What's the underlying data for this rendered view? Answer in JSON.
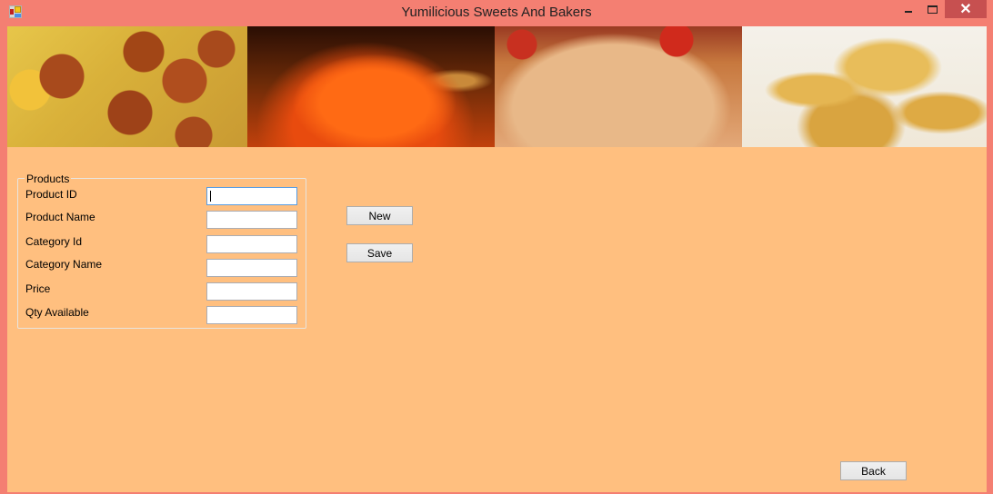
{
  "window": {
    "title": "Yumilicious Sweets And Bakers",
    "icon": "app-icon",
    "controls": {
      "minimize": "minimize-icon",
      "maximize": "maximize-icon",
      "close": "✕"
    }
  },
  "banner": {
    "images": [
      {
        "name": "gulab-jamun-image"
      },
      {
        "name": "jalebi-image"
      },
      {
        "name": "pizza-image"
      },
      {
        "name": "samosa-image"
      }
    ]
  },
  "products_group": {
    "title": "Products",
    "fields": [
      {
        "label": "Product ID",
        "value": "",
        "focused": true
      },
      {
        "label": "Product Name",
        "value": ""
      },
      {
        "label": "Category Id",
        "value": ""
      },
      {
        "label": "Category Name",
        "value": ""
      },
      {
        "label": "Price",
        "value": ""
      },
      {
        "label": "Qty Available",
        "value": ""
      }
    ]
  },
  "buttons": {
    "new": "New",
    "save": "Save",
    "back": "Back"
  },
  "colors": {
    "titlebar": "#f47f72",
    "client_background": "#ffbf7f",
    "close_button": "#c75050"
  }
}
